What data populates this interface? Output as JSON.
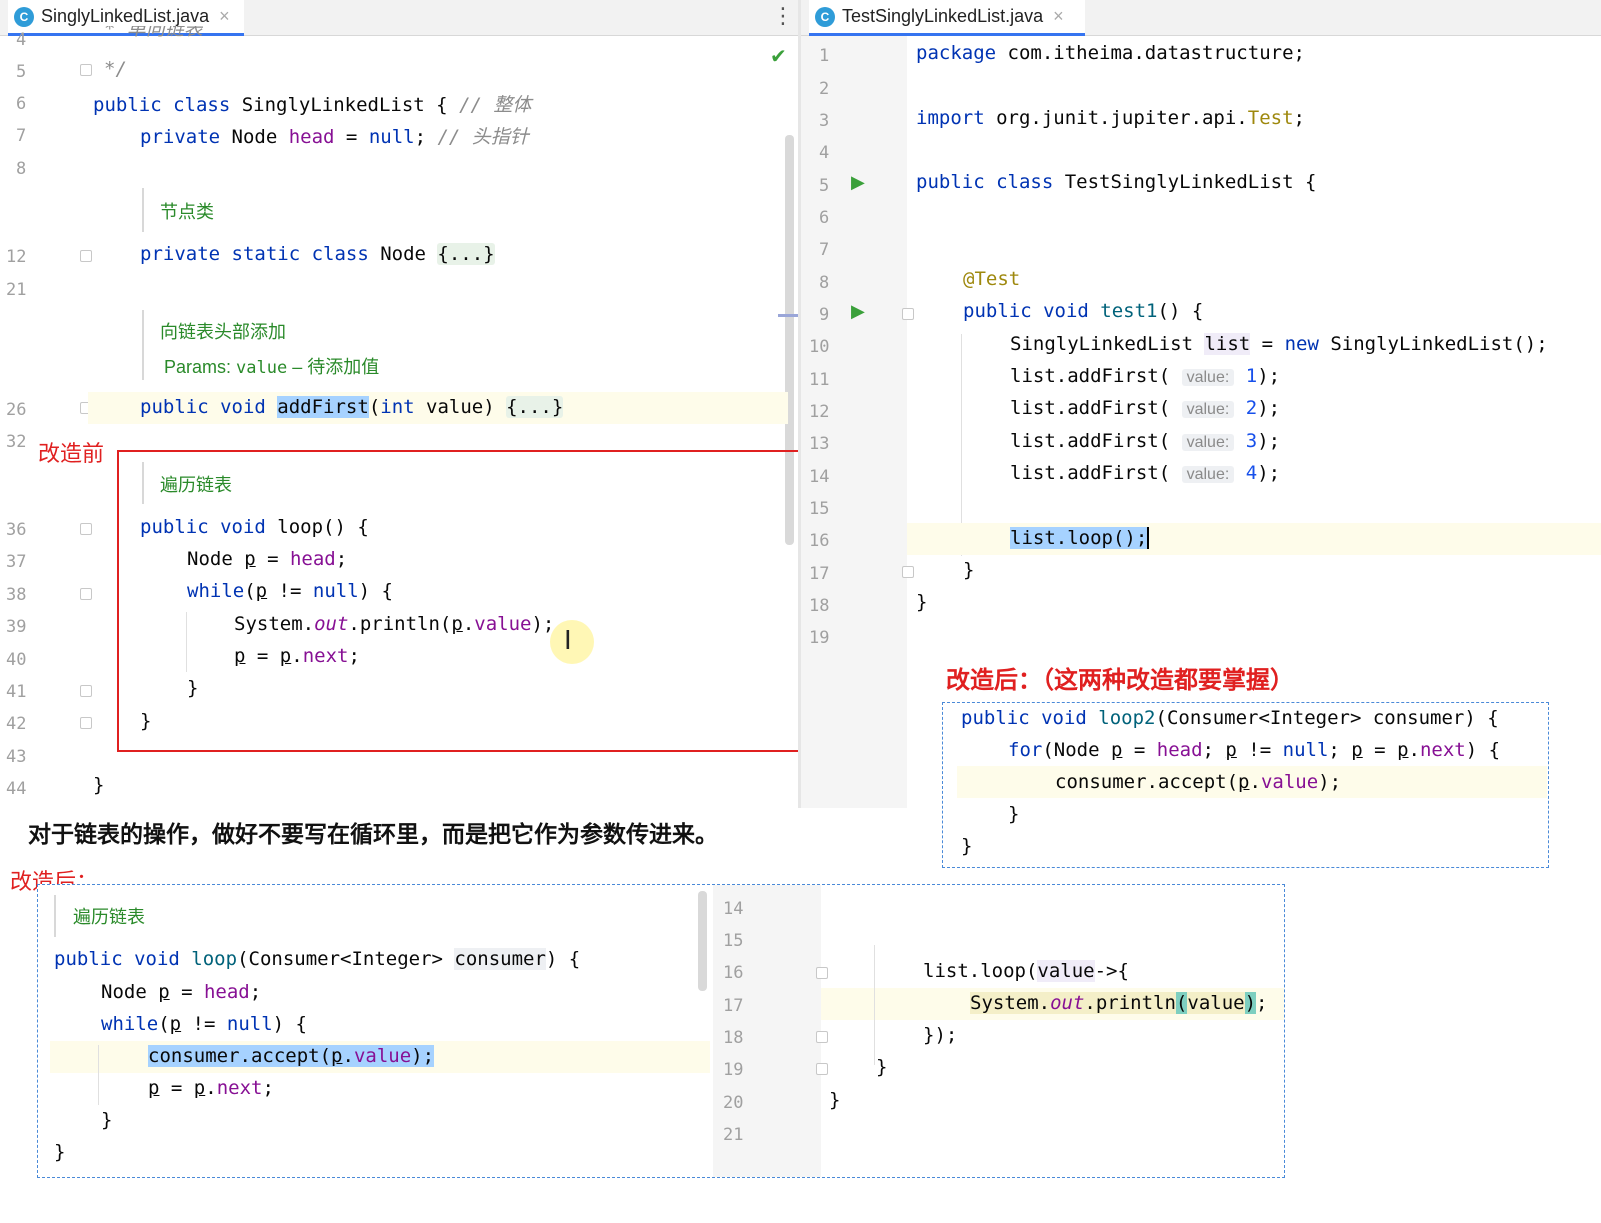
{
  "left_tab": {
    "label": "SinglyLinkedList.java",
    "close": "×"
  },
  "right_tab": {
    "label": "TestSinglyLinkedList.java",
    "close": "×"
  },
  "menu_dots": "⋮",
  "left_editor": {
    "line_numbers": [
      "4",
      "5",
      "6",
      "7",
      "8",
      "12",
      "21",
      "26",
      "32",
      "36",
      "37",
      "38",
      "39",
      "40",
      "41",
      "42",
      "43",
      "44"
    ],
    "l4_text": "* 单向链表",
    "l5_text": "*/",
    "l6_comment": "// 整体",
    "l7_comment": "// 头指针",
    "doc_node": "节点类",
    "fold_node": "{...}",
    "doc_addfirst": "向链表头部添加",
    "doc_params_label": "Params:",
    "doc_params_name": "value",
    "doc_params_desc": "– 待添加值",
    "method_addfirst": "addFirst",
    "fold_addfirst": "{...}",
    "doc_loop": "遍历链表"
  },
  "right_editor": {
    "line_numbers": [
      "1",
      "2",
      "3",
      "4",
      "5",
      "6",
      "7",
      "8",
      "9",
      "10",
      "11",
      "12",
      "13",
      "14",
      "15",
      "16",
      "17",
      "18",
      "19"
    ],
    "package_name": "com.itheima.datastructure;",
    "import_path": "org.junit.jupiter.api.",
    "import_class": "Test",
    "class_name": "TestSinglyLinkedList",
    "annotation": "@Test",
    "method_name": "test1",
    "hint_label": "value:",
    "values": [
      "1",
      "2",
      "3",
      "4"
    ]
  },
  "annotations": {
    "before_label": "改造前",
    "after_label_right": "改造后：（这两种改造都要掌握）",
    "after_label_bottom": "改造后：",
    "note": "对于链表的操作，做好不要写在循环里，而是把它作为参数传进来。"
  },
  "bottom_left": {
    "doc_loop": "遍历链表"
  },
  "bottom_right": {
    "line_numbers": [
      "14",
      "15",
      "16",
      "17",
      "18",
      "19",
      "20",
      "21"
    ]
  },
  "colors": {
    "keyword": "#0033b3",
    "field": "#871094",
    "doc": "#2a8a2a",
    "red": "#e02020",
    "selection": "#a6d2ff"
  }
}
